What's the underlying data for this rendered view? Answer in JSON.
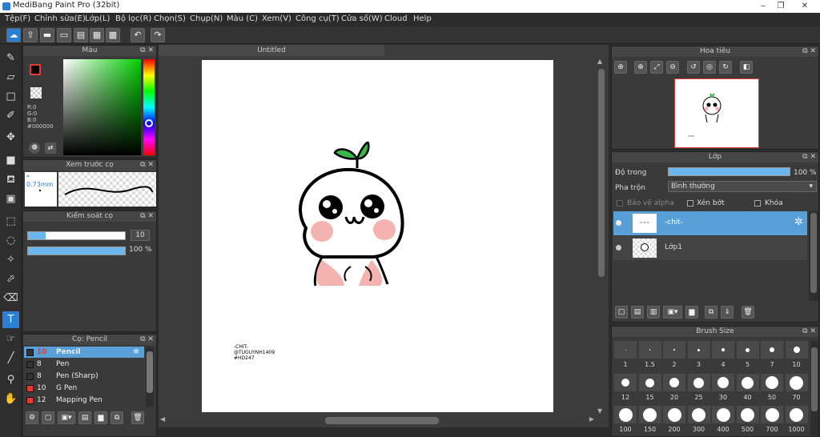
{
  "app": {
    "title": "MediBang Paint Pro (32bit)"
  },
  "menu": [
    "Tệp(F)",
    "Chỉnh sửa(E)",
    "Lớp(L)",
    "Bộ lọc(R)",
    "Chọn(S)",
    "Chụp(N)",
    "Màu (C)",
    "Xem(V)",
    "Công cụ(T)",
    "Cửa số(W)",
    "Cloud",
    "Help"
  ],
  "color_panel": {
    "title": "Màu",
    "r": "R:0",
    "g": "G:0",
    "b": "B:0",
    "hex": "#000000"
  },
  "brush_preview": {
    "title": "Xem trước cọ",
    "size": "0.73mm"
  },
  "brush_control": {
    "title": "Kiểm soát cọ",
    "size_value": "10",
    "opacity_value": "100 %"
  },
  "brush_list": {
    "title": "Cọ: Pencil",
    "items": [
      {
        "size": "10",
        "name": "Pencil",
        "selected": true,
        "color": "dark"
      },
      {
        "size": "8",
        "name": "Pen",
        "color": "dark"
      },
      {
        "size": "8",
        "name": "Pen (Sharp)",
        "color": "dark"
      },
      {
        "size": "10",
        "name": "G Pen",
        "color": "red"
      },
      {
        "size": "12",
        "name": "Mapping Pen",
        "color": "red"
      }
    ]
  },
  "canvas": {
    "tab_title": "Untitled",
    "sketch_text_lines": [
      "-CHIT-",
      "@TUGUYNH1409",
      "#HD247"
    ]
  },
  "navigator": {
    "title": "Hoa tiêu"
  },
  "layers": {
    "title": "Lớp",
    "opacity_label": "Độ trong",
    "opacity_value": "100 %",
    "blend_label": "Pha trộn",
    "blend_value": "Bình thường",
    "protect_alpha": "Bảo vệ alpha",
    "clipping": "Xén bớt",
    "lock": "Khóa",
    "items": [
      {
        "name": "-chit-",
        "selected": true
      },
      {
        "name": "Lớp1",
        "selected": false
      }
    ]
  },
  "brush_size": {
    "title": "Brush Size",
    "rows": [
      [
        "1",
        "1.5",
        "2",
        "3",
        "4",
        "5",
        "7",
        "10"
      ],
      [
        "12",
        "15",
        "20",
        "25",
        "30",
        "40",
        "50",
        "70"
      ],
      [
        "100",
        "150",
        "200",
        "300",
        "400",
        "500",
        "700",
        "1000"
      ]
    ]
  },
  "colors": {
    "accent": "#2a7fd4",
    "panel": "#3a3a3a",
    "header": "#454545",
    "bg": "#2b2b2b"
  }
}
